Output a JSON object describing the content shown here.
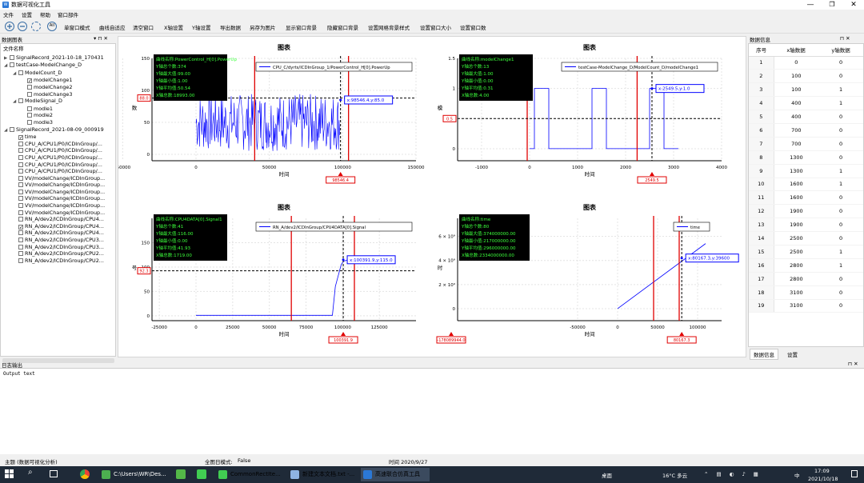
{
  "window": {
    "title": "数据可视化工具",
    "controls": [
      "—",
      "❐",
      "✕"
    ]
  },
  "menu": [
    "文件",
    "设置",
    "帮助",
    "窗口部件"
  ],
  "toolbar": {
    "icons": [
      "zoom-in-icon",
      "zoom-out-icon",
      "refresh-icon",
      "all-icon"
    ],
    "all_label": "All",
    "buttons": [
      "单窗口模式",
      "曲线自适应",
      "清空窗口",
      "X轴设置",
      "Y轴设置",
      "导出数据",
      "另存为图片",
      "显示窗口背景",
      "隐藏窗口背景",
      "设置网格背景样式",
      "设置窗口大小",
      "设置窗口数"
    ]
  },
  "left_panel": {
    "title": "数据图表",
    "header": "文件名称",
    "tree": [
      {
        "level": 0,
        "expand": "▶",
        "check": false,
        "text": "SignalRecord_2021-10-18_170431"
      },
      {
        "level": 0,
        "expand": "◢",
        "check": false,
        "text": "testCase-ModelChange_D"
      },
      {
        "level": 1,
        "expand": "◢",
        "check": false,
        "text": "ModelCount_D"
      },
      {
        "level": 2,
        "expand": "",
        "check": true,
        "text": "modelChange1"
      },
      {
        "level": 2,
        "expand": "",
        "check": false,
        "text": "modelChange2"
      },
      {
        "level": 2,
        "expand": "",
        "check": false,
        "text": "modelChange3"
      },
      {
        "level": 1,
        "expand": "◢",
        "check": false,
        "text": "ModleSignal_D"
      },
      {
        "level": 2,
        "expand": "",
        "check": false,
        "text": "modle1"
      },
      {
        "level": 2,
        "expand": "",
        "check": false,
        "text": "modle2"
      },
      {
        "level": 2,
        "expand": "",
        "check": false,
        "text": "modle3"
      },
      {
        "level": 0,
        "expand": "◢",
        "check": false,
        "text": "SignalRecord_2021-08-09_000919"
      },
      {
        "level": 1,
        "expand": "",
        "check": true,
        "text": "time"
      },
      {
        "level": 1,
        "expand": "",
        "check": false,
        "text": "CPU_A/CPU1/P0/ICDInGroup/..."
      },
      {
        "level": 1,
        "expand": "",
        "check": false,
        "text": "CPU_A/CPU1/P0/ICDInGroup/..."
      },
      {
        "level": 1,
        "expand": "",
        "check": false,
        "text": "CPU_A/CPU1/P0/ICDInGroup/..."
      },
      {
        "level": 1,
        "expand": "",
        "check": false,
        "text": "CPU_A/CPU1/P0/ICDInGroup/..."
      },
      {
        "level": 1,
        "expand": "",
        "check": false,
        "text": "CPU_A/CPU1/P0/ICDInGroup/..."
      },
      {
        "level": 1,
        "expand": "",
        "check": false,
        "text": "VV/modelChange/ICDInGroup..."
      },
      {
        "level": 1,
        "expand": "",
        "check": false,
        "text": "VV/modelChange/ICDInGroup..."
      },
      {
        "level": 1,
        "expand": "",
        "check": false,
        "text": "VV/modelChange/ICDInGroup..."
      },
      {
        "level": 1,
        "expand": "",
        "check": false,
        "text": "VV/modelChange/ICDInGroup..."
      },
      {
        "level": 1,
        "expand": "",
        "check": false,
        "text": "VV/modelChange/ICDInGroup..."
      },
      {
        "level": 1,
        "expand": "",
        "check": false,
        "text": "VV/modelChange/ICDInGroup..."
      },
      {
        "level": 1,
        "expand": "",
        "check": false,
        "text": "RN_A/dev2/ICDInGroup/CPU4..."
      },
      {
        "level": 1,
        "expand": "",
        "check": true,
        "text": "RN_A/dev2/ICDInGroup/CPU4..."
      },
      {
        "level": 1,
        "expand": "",
        "check": false,
        "text": "RN_A/dev2/ICDInGroup/CPU4..."
      },
      {
        "level": 1,
        "expand": "",
        "check": false,
        "text": "RN_A/dev2/ICDInGroup/CPU3..."
      },
      {
        "level": 1,
        "expand": "",
        "check": false,
        "text": "RN_A/dev2/ICDInGroup/CPU3..."
      },
      {
        "level": 1,
        "expand": "",
        "check": false,
        "text": "RN_A/dev2/ICDInGroup/CPU2..."
      },
      {
        "level": 1,
        "expand": "",
        "check": false,
        "text": "RN_A/dev2/ICDInGroup/CPU2..."
      }
    ]
  },
  "right_panel": {
    "title": "数据信息",
    "columns": [
      "序号",
      "x轴数据",
      "y轴数据"
    ],
    "rows": [
      [
        "1",
        "0",
        "0"
      ],
      [
        "2",
        "100",
        "0"
      ],
      [
        "3",
        "100",
        "1"
      ],
      [
        "4",
        "400",
        "1"
      ],
      [
        "5",
        "400",
        "0"
      ],
      [
        "6",
        "700",
        "0"
      ],
      [
        "7",
        "700",
        "0"
      ],
      [
        "8",
        "1300",
        "0"
      ],
      [
        "9",
        "1300",
        "1"
      ],
      [
        "10",
        "1600",
        "1"
      ],
      [
        "11",
        "1600",
        "0"
      ],
      [
        "12",
        "1900",
        "0"
      ],
      [
        "13",
        "1900",
        "0"
      ],
      [
        "14",
        "2500",
        "0"
      ],
      [
        "15",
        "2500",
        "1"
      ],
      [
        "16",
        "2800",
        "1"
      ],
      [
        "17",
        "2800",
        "0"
      ],
      [
        "18",
        "3100",
        "0"
      ],
      [
        "19",
        "3100",
        "0"
      ]
    ],
    "tabs": [
      "数据信息",
      "设置"
    ]
  },
  "log": {
    "title": "日志输出",
    "text": "Output text"
  },
  "status": {
    "left": "主题 (数据可视化分析)",
    "mid": "全图日模式:",
    "mid_val": "False",
    "time": "时间 2020/9/27"
  },
  "taskbar": {
    "apps": [
      "C:\\Users\\WR\\Des...",
      "CommonRectIte...",
      "新建文本文档.txt -...",
      "高速联合仿真工具"
    ],
    "desktop": "桌面",
    "weather": "16°C 多云",
    "ime": "中",
    "clock": "17:09",
    "date": "2021/10/18"
  },
  "chart_data": [
    {
      "type": "line",
      "title": "图表",
      "xlabel": "时间",
      "ylabel": "数",
      "xlim": [
        -30000,
        150000
      ],
      "ylim": [
        -10,
        150
      ],
      "xticks": [
        "-50000",
        "0",
        "50000",
        "100000",
        "150000"
      ],
      "yticks": [
        "0",
        "50",
        "100",
        "150"
      ],
      "series": [
        {
          "name": "CPU_C/dyrts/ICDInGroup_1/PowerControl_H[0].PowerUp",
          "color": "#0000ff"
        }
      ],
      "info": [
        "曲线名称:PowerControl_H[0].PowerUp",
        "Y轴总个数:374",
        "Y轴最大值:99.00",
        "Y轴最小值:1.00",
        "Y轴平均值:50.54",
        "X轴总数:18993.00"
      ],
      "markers": [
        "98546.4"
      ],
      "hline_value": "88.0",
      "cursor_label": "x:98546.4,y:85.0"
    },
    {
      "type": "line",
      "title": "图表",
      "xlabel": "时间",
      "ylabel": "模",
      "xlim": [
        -1500,
        4000
      ],
      "ylim": [
        -0.2,
        1.5
      ],
      "xticks": [
        "-1000",
        "0",
        "1000",
        "2000",
        "3000",
        "4000"
      ],
      "yticks": [
        "0",
        "0.5",
        "1",
        "1.5"
      ],
      "x": [
        0,
        100,
        100,
        400,
        400,
        700,
        700,
        1300,
        1300,
        1600,
        1600,
        1900,
        1900,
        2500,
        2500,
        2800,
        2800,
        3100
      ],
      "y": [
        0,
        0,
        1,
        1,
        0,
        0,
        0,
        0,
        1,
        1,
        0,
        0,
        0,
        0,
        1,
        1,
        0,
        0
      ],
      "series": [
        {
          "name": "testCase-ModelChange_D/ModelCount_D/modelChange1",
          "color": "#0000ff"
        }
      ],
      "info": [
        "曲线名称:modelChange1",
        "Y轴总个数:13",
        "Y轴最大值:1.00",
        "Y轴最小值:0.00",
        "Y轴平均值:0.31",
        "X轴总数:4.00"
      ],
      "markers": [
        "2549.5"
      ],
      "hline_value": "0.5",
      "cursor_label": "x:2549.5,y:1.0"
    },
    {
      "type": "line",
      "title": "图表",
      "xlabel": "时间",
      "ylabel": "号",
      "xlim": [
        -30000,
        150000
      ],
      "ylim": [
        -10,
        200
      ],
      "xticks": [
        "-25000",
        "0",
        "25000",
        "50000",
        "75000",
        "100000",
        "125000"
      ],
      "yticks": [
        "0",
        "50",
        "100",
        "150"
      ],
      "series": [
        {
          "name": "RN_A/dev2/ICDInGroup/CPU4DATA[0].Signal",
          "color": "#0000ff"
        }
      ],
      "info": [
        "曲线名称:CPU4DATA[0].Signal1",
        "Y轴总个数:41",
        "Y轴最大值:116.00",
        "Y轴最小值:0.00",
        "Y轴平均值:41.93",
        "X轴总数:1719.00"
      ],
      "markers": [
        "100391.9"
      ],
      "hline_value": "92.3",
      "cursor_label": "x:100391.9,y:115.0"
    },
    {
      "type": "line",
      "title": "图表",
      "xlabel": "时间",
      "ylabel": "时",
      "xlim": [
        -200000,
        130000
      ],
      "ylim": [
        -1,
        7.5
      ],
      "xticks": [
        "-50000",
        "0",
        "50000",
        "100000"
      ],
      "yticks": [
        "0",
        "2 × 10⁹",
        "4 × 10⁹",
        "6 × 10⁹"
      ],
      "series": [
        {
          "name": "time",
          "color": "#0000ff"
        }
      ],
      "info": [
        "曲线名称:time",
        "Y轴总个数:80",
        "Y轴最大值:374000000.00",
        "Y轴最小值:217000000.00",
        "Y轴平均值:296000000.00",
        "X轴总数:2334000000.00"
      ],
      "markers": [
        "-178089944.0",
        "80167.3"
      ],
      "cursor_label": "x:80167.3,y:39600"
    }
  ]
}
